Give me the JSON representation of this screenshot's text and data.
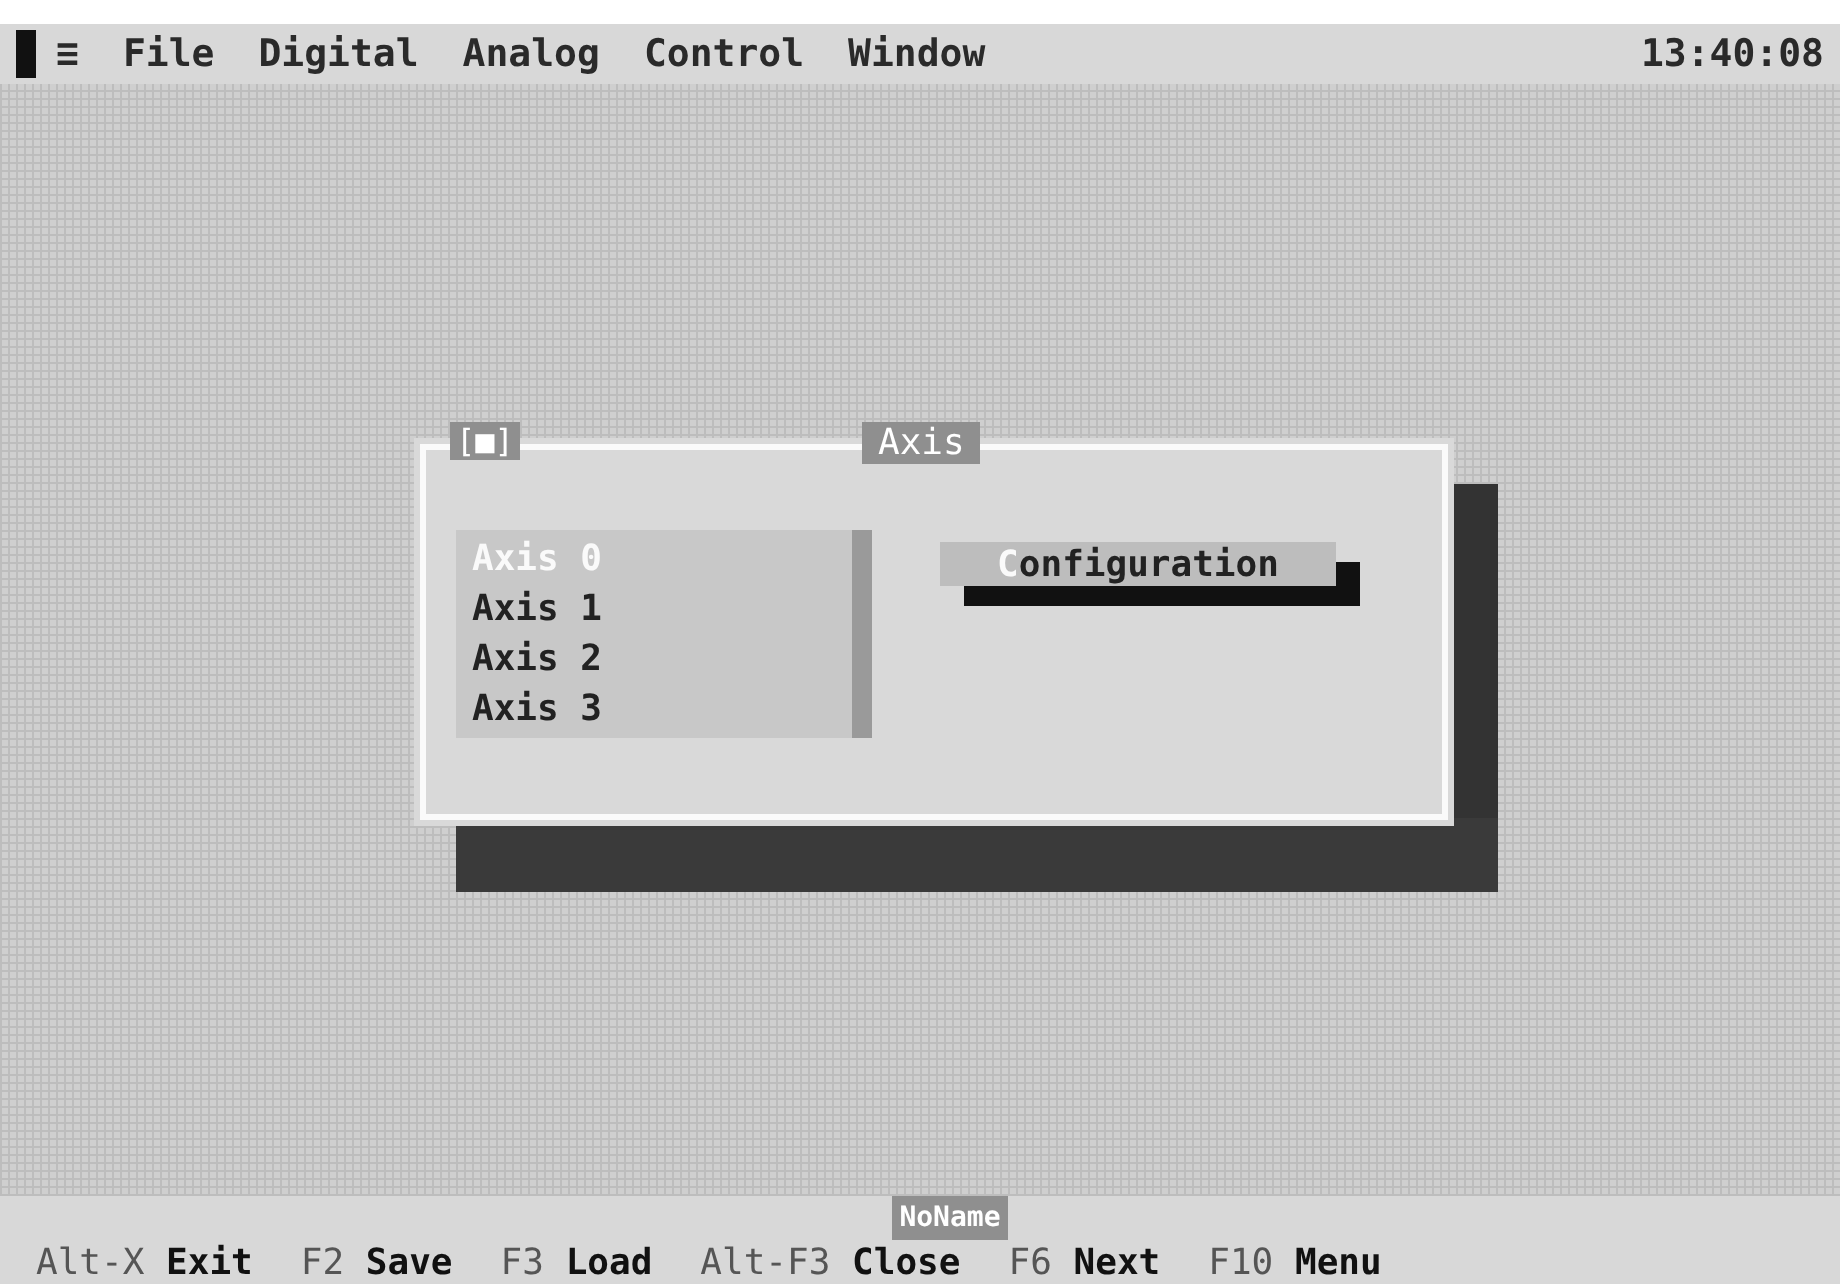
{
  "menu_bar": {
    "items": [
      {
        "label": "≡"
      },
      {
        "label": "File"
      },
      {
        "label": "Digital"
      },
      {
        "label": "Analog"
      },
      {
        "label": "Control"
      },
      {
        "label": "Window"
      }
    ],
    "clock": "13:40:08"
  },
  "dialog": {
    "close_box": "[■]",
    "title": "Axis",
    "list": [
      {
        "label": "Axis 0",
        "selected": true
      },
      {
        "label": "Axis 1",
        "selected": false
      },
      {
        "label": "Axis 2",
        "selected": false
      },
      {
        "label": "Axis 3",
        "selected": false
      }
    ],
    "button": {
      "hotkey": "C",
      "label": "onfiguration"
    }
  },
  "file_name": "NoName",
  "status_bar": [
    {
      "key": "Alt-X",
      "label": "Exit"
    },
    {
      "key": "F2",
      "label": "Save"
    },
    {
      "key": "F3",
      "label": "Load"
    },
    {
      "key": "Alt-F3",
      "label": "Close"
    },
    {
      "key": "F6",
      "label": "Next"
    },
    {
      "key": "F10",
      "label": "Menu"
    }
  ]
}
